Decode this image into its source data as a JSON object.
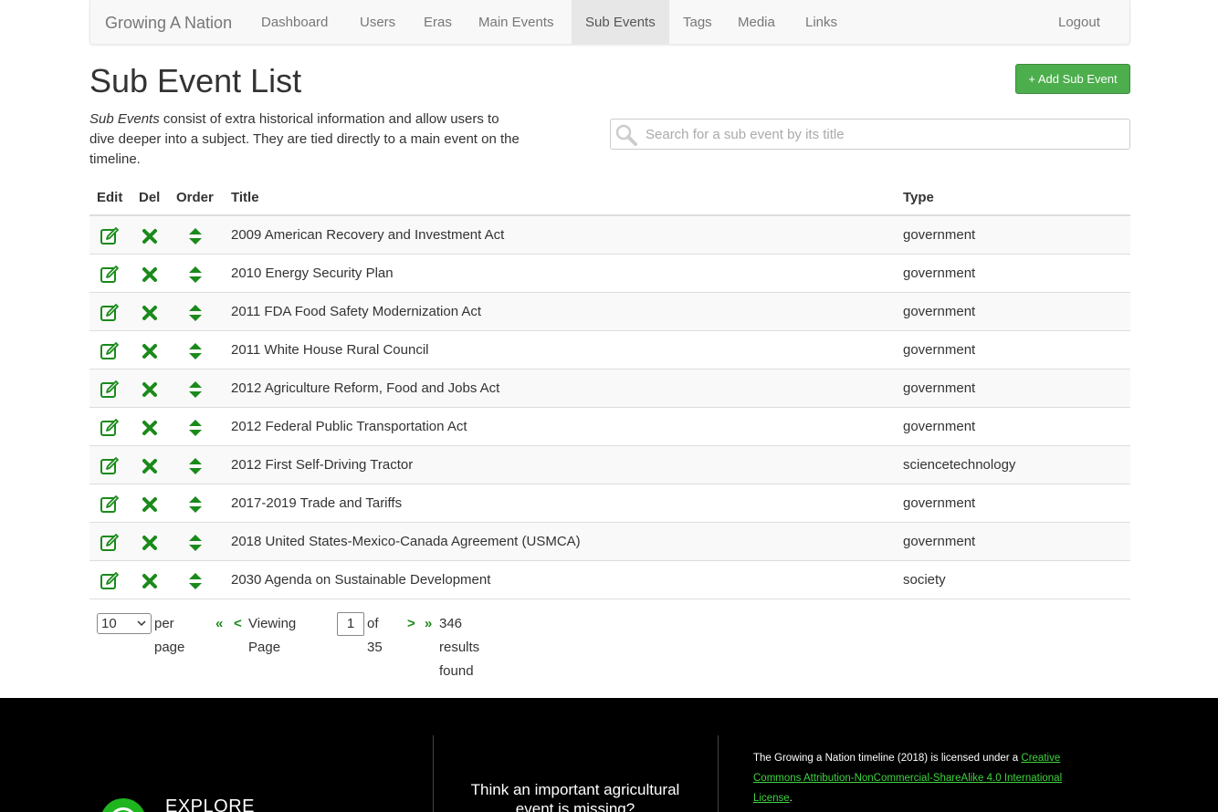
{
  "nav": {
    "brand": "Growing A Nation",
    "items": [
      {
        "label": "Dashboard",
        "active": false
      },
      {
        "label": "Users",
        "active": false
      },
      {
        "label": "Eras",
        "active": false
      },
      {
        "label": "Main Events",
        "active": false
      },
      {
        "label": "Sub Events",
        "active": true
      },
      {
        "label": "Tags",
        "active": false
      },
      {
        "label": "Media",
        "active": false
      },
      {
        "label": "Links",
        "active": false
      }
    ],
    "logout": "Logout"
  },
  "page": {
    "title": "Sub Event List",
    "add_button": "+ Add Sub Event",
    "intro_em": "Sub Events",
    "intro_rest": " consist of extra historical information and allow users to dive deeper into a subject. They are tied directly to a main event on the timeline."
  },
  "search": {
    "placeholder": "Search for a sub event by its title",
    "value": ""
  },
  "table": {
    "headers": {
      "edit": "Edit",
      "del": "Del",
      "order": "Order",
      "title": "Title",
      "type": "Type"
    },
    "rows": [
      {
        "title": "2009 American Recovery and Investment Act",
        "type": "government"
      },
      {
        "title": "2010 Energy Security Plan",
        "type": "government"
      },
      {
        "title": "2011 FDA Food Safety Modernization Act",
        "type": "government"
      },
      {
        "title": "2011 White House Rural Council",
        "type": "government"
      },
      {
        "title": "2012 Agriculture Reform, Food and Jobs Act",
        "type": "government"
      },
      {
        "title": "2012 Federal Public Transportation Act",
        "type": "government"
      },
      {
        "title": "2012 First Self-Driving Tractor",
        "type": "sciencetechnology"
      },
      {
        "title": "2017-2019 Trade and Tariffs",
        "type": "government"
      },
      {
        "title": "2018 United States-Mexico-Canada Agreement (USMCA)",
        "type": "government"
      },
      {
        "title": "2030 Agenda on Sustainable Development",
        "type": "society"
      }
    ]
  },
  "pager": {
    "per_page": "10",
    "per_page_label": "per page",
    "first": "«",
    "prev": "<",
    "viewing": "Viewing Page",
    "current_page": "1",
    "of_label": "of 35",
    "next": ">",
    "last": "»",
    "results": "346 results found"
  },
  "footer": {
    "explore": "EXPLORE",
    "missing": "Think an important agricultural event is missing?",
    "license_prefix": "The Growing a Nation timeline (2018) is licensed under a ",
    "license_link": "Creative Commons Attribution-NonCommercial-ShareAlike 4.0 International License",
    "license_suffix": "."
  },
  "colors": {
    "accent_green": "#1a8a1a",
    "button_green": "#4cae4c",
    "footer_bg": "#000000",
    "link_green": "#3ed23e"
  },
  "icons": {
    "edit": "edit-icon",
    "delete": "delete-icon",
    "order": "reorder-icon",
    "search": "search-icon"
  }
}
